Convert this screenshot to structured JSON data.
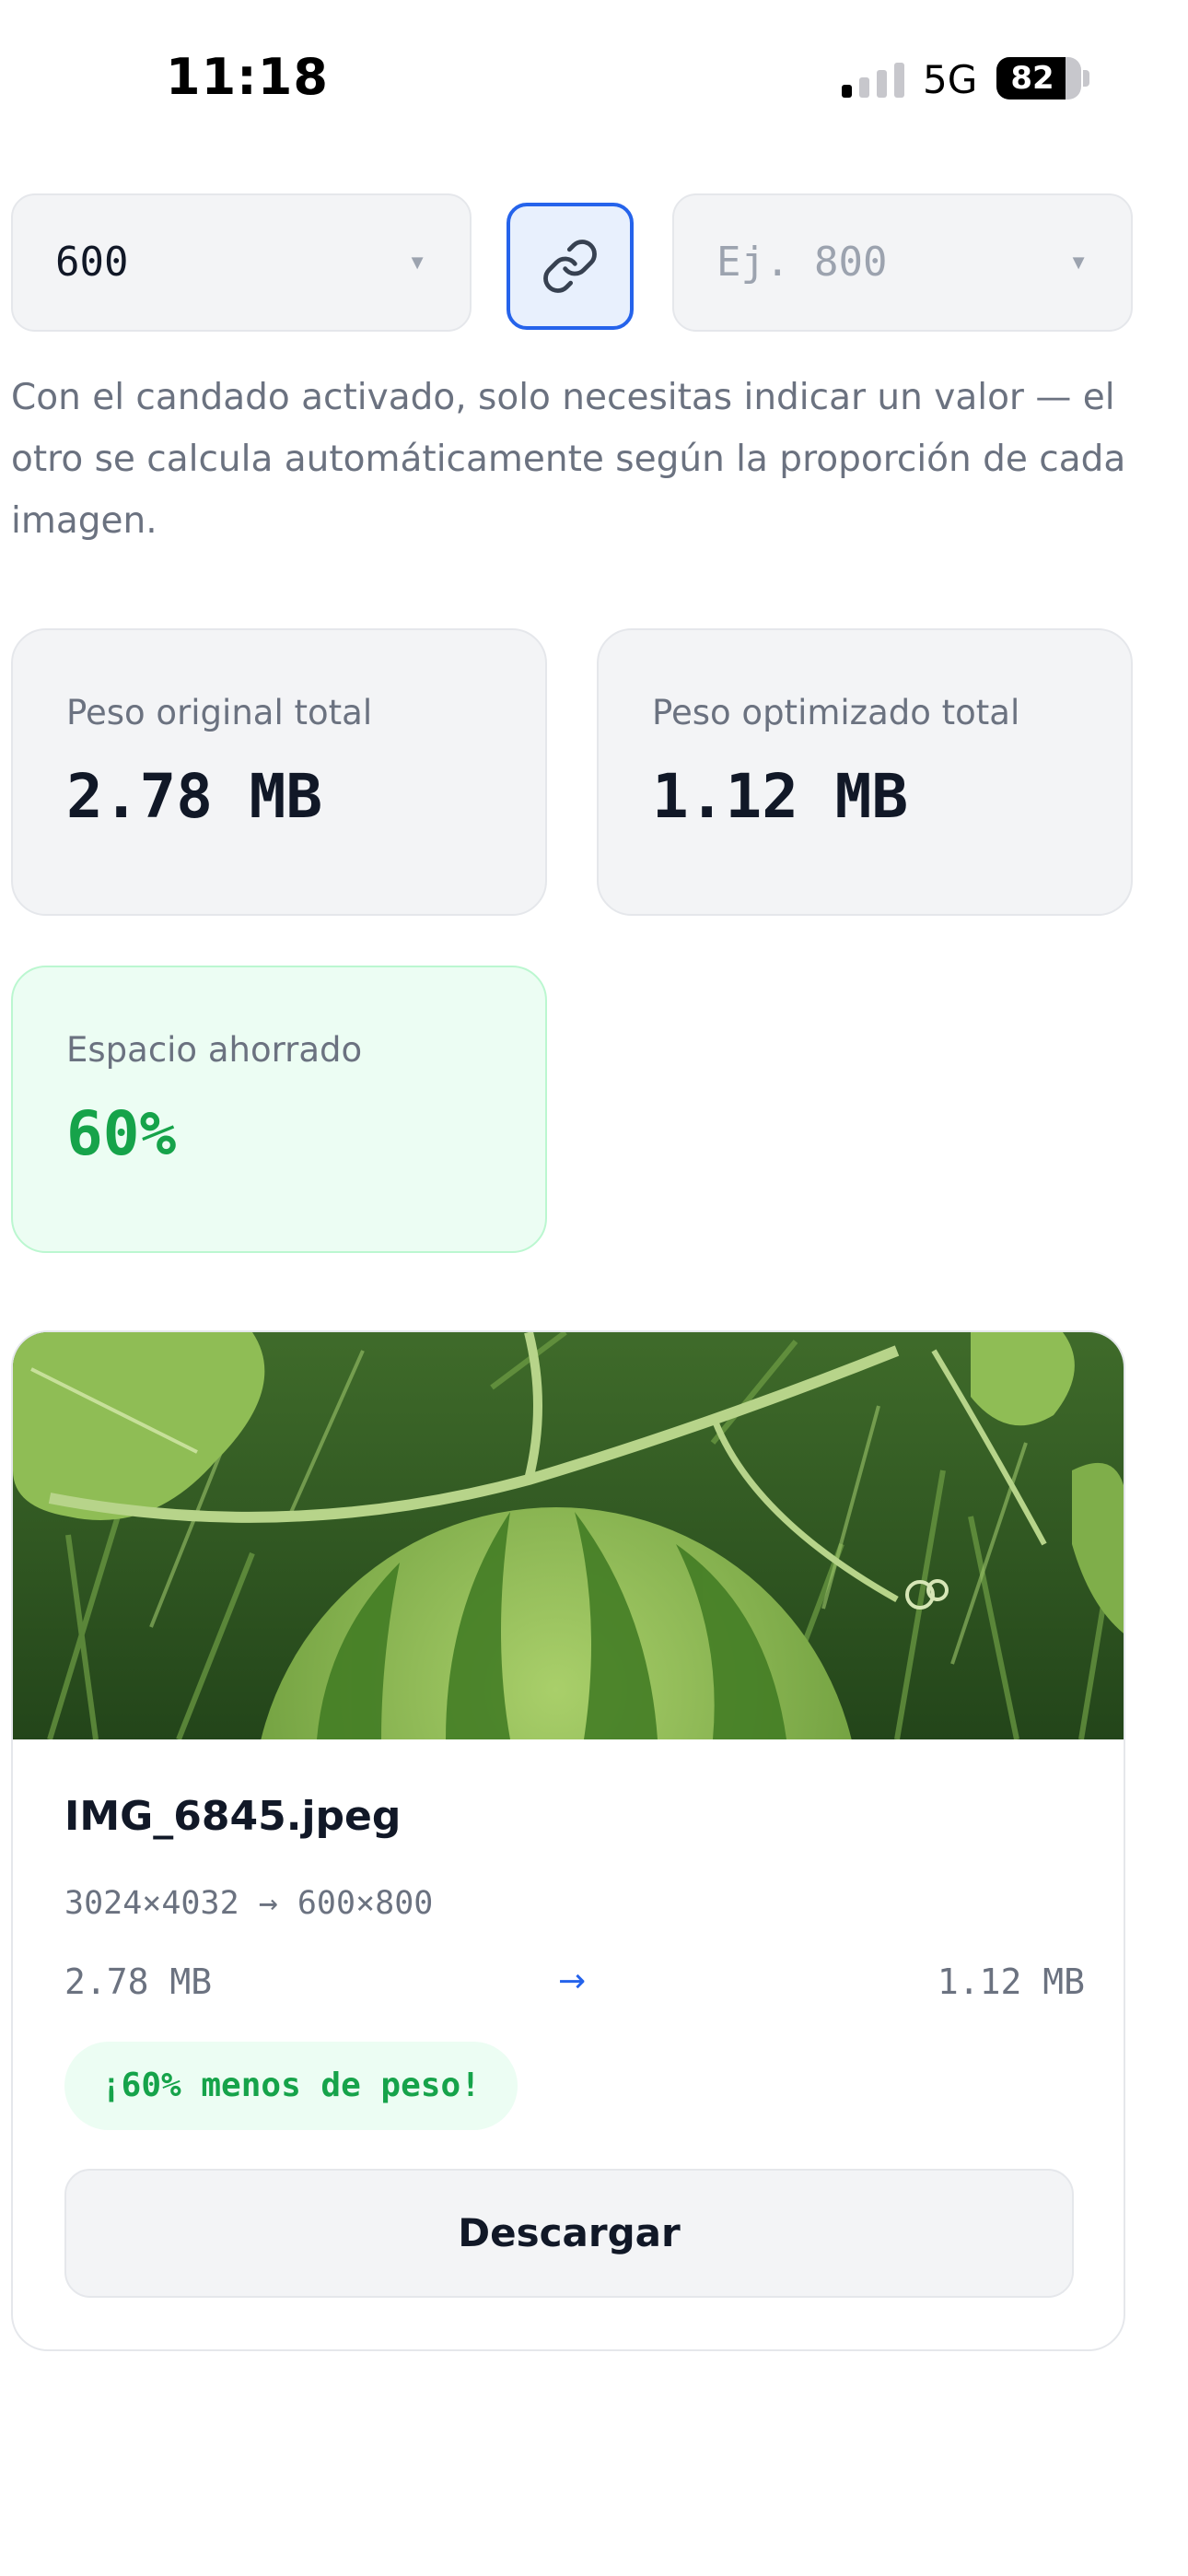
{
  "status_bar": {
    "time": "11:18",
    "network": "5G",
    "battery": "82",
    "battery_level": 0.82,
    "signal_bars_active": 1,
    "signal_bars_total": 4
  },
  "dimensions": {
    "width_value": "600",
    "height_placeholder": "Ej. 800",
    "aspect_lock_active": true,
    "hint": "Con el candado activado, solo necesitas indicar un valor — el otro se calcula automáticamente según la proporción de cada imagen."
  },
  "stats": {
    "original_label": "Peso original total",
    "original_value": "2.78 MB",
    "optimized_label": "Peso optimizado total",
    "optimized_value": "1.12 MB",
    "saved_label": "Espacio ahorrado",
    "saved_value": "60%"
  },
  "image_card": {
    "file_name": "IMG_6845.jpeg",
    "dims": "3024×4032 → 600×800",
    "size_original": "2.78 MB",
    "arrow": "→",
    "size_new": "1.12 MB",
    "badge": "¡60% menos de peso!",
    "download_label": "Descargar"
  },
  "colors": {
    "accent": "#2563eb",
    "success": "#16a34a",
    "success_bg": "#ecfdf3",
    "muted_text": "#6b7280"
  },
  "icons": {
    "lock": "link-icon",
    "caret": "chevron-down-icon"
  }
}
